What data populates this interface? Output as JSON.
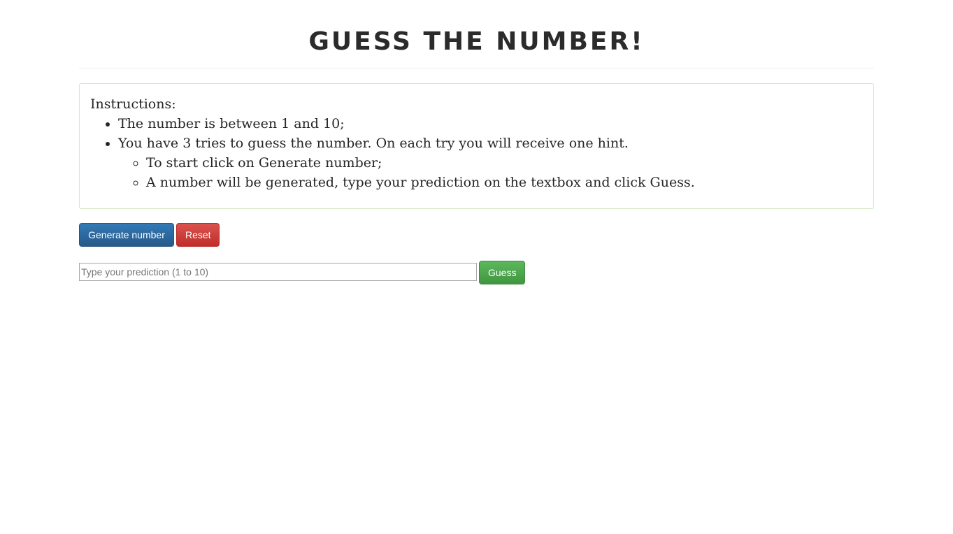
{
  "header": {
    "title": "Guess the number!"
  },
  "instructions": {
    "title": "Instructions:",
    "items": [
      "The number is between 1 and 10;",
      "You have 3 tries to guess the number. On each try you will receive one hint."
    ],
    "subitems": [
      "To start click on Generate number;",
      "A number will be generated, type your prediction on the textbox and click Guess."
    ]
  },
  "controls": {
    "generate_label": "Generate number",
    "reset_label": "Reset",
    "guess_label": "Guess",
    "prediction_placeholder": "Type your prediction (1 to 10)",
    "prediction_value": ""
  },
  "colors": {
    "generate_button": "#2d6ca2",
    "reset_button": "#d2322d",
    "guess_button": "#4cae4c",
    "instructions_border": "#d6e9c6"
  }
}
